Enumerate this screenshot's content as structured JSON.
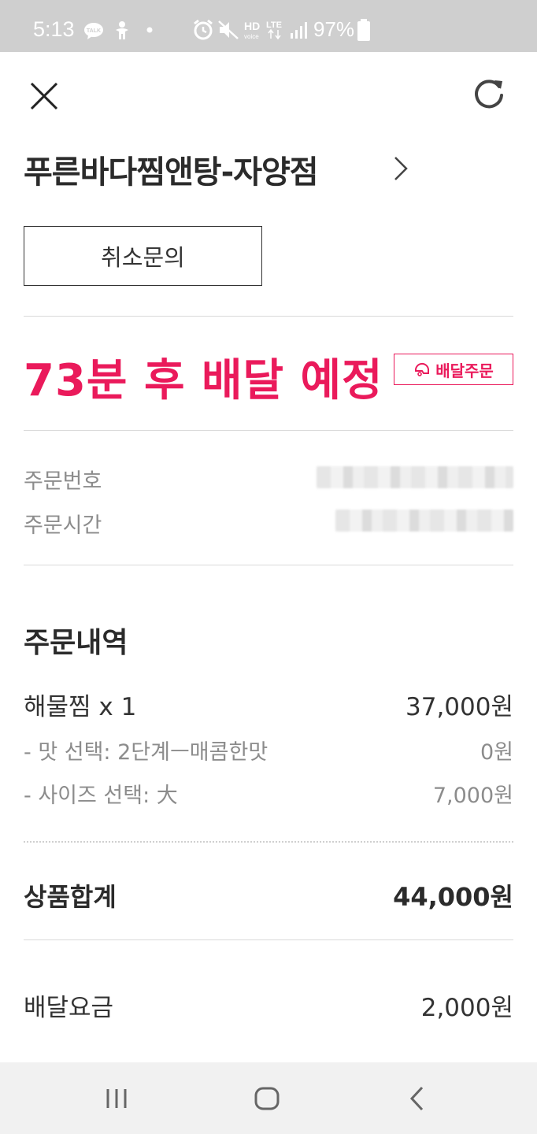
{
  "status_bar": {
    "time": "5:13",
    "battery": "97%",
    "icons": [
      "talk-icon",
      "accessibility-icon",
      "dot-icon",
      "alarm-icon",
      "mute-icon",
      "hd-voice-icon",
      "lte-icon",
      "signal-icon",
      "battery-icon"
    ],
    "hd_label": "HD",
    "lte_label": "LTE"
  },
  "header": {
    "store_name": "푸른바다찜앤탕-자양점",
    "cancel_button": "취소문의"
  },
  "delivery": {
    "eta_text": "73분 후 배달 예정",
    "badge_label": "배달주문",
    "accent_color": "#ea1a5b"
  },
  "order_info": {
    "number_label": "주문번호",
    "time_label": "주문시간"
  },
  "order_details": {
    "title": "주문내역",
    "item": {
      "name": "해물찜 x 1",
      "price": "37,000원"
    },
    "options": [
      {
        "name": "- 맛 선택: 2단계ㅡ매콤한맛",
        "price": "0원"
      },
      {
        "name": "- 사이즈 선택: 大",
        "price": "7,000원"
      }
    ],
    "subtotal_label": "상품합계",
    "subtotal_value": "44,000원",
    "delivery_fee_label": "배달요금",
    "delivery_fee_value": "2,000원"
  },
  "nav_bar": {
    "buttons": [
      "recent-apps-icon",
      "home-icon",
      "back-icon"
    ]
  }
}
